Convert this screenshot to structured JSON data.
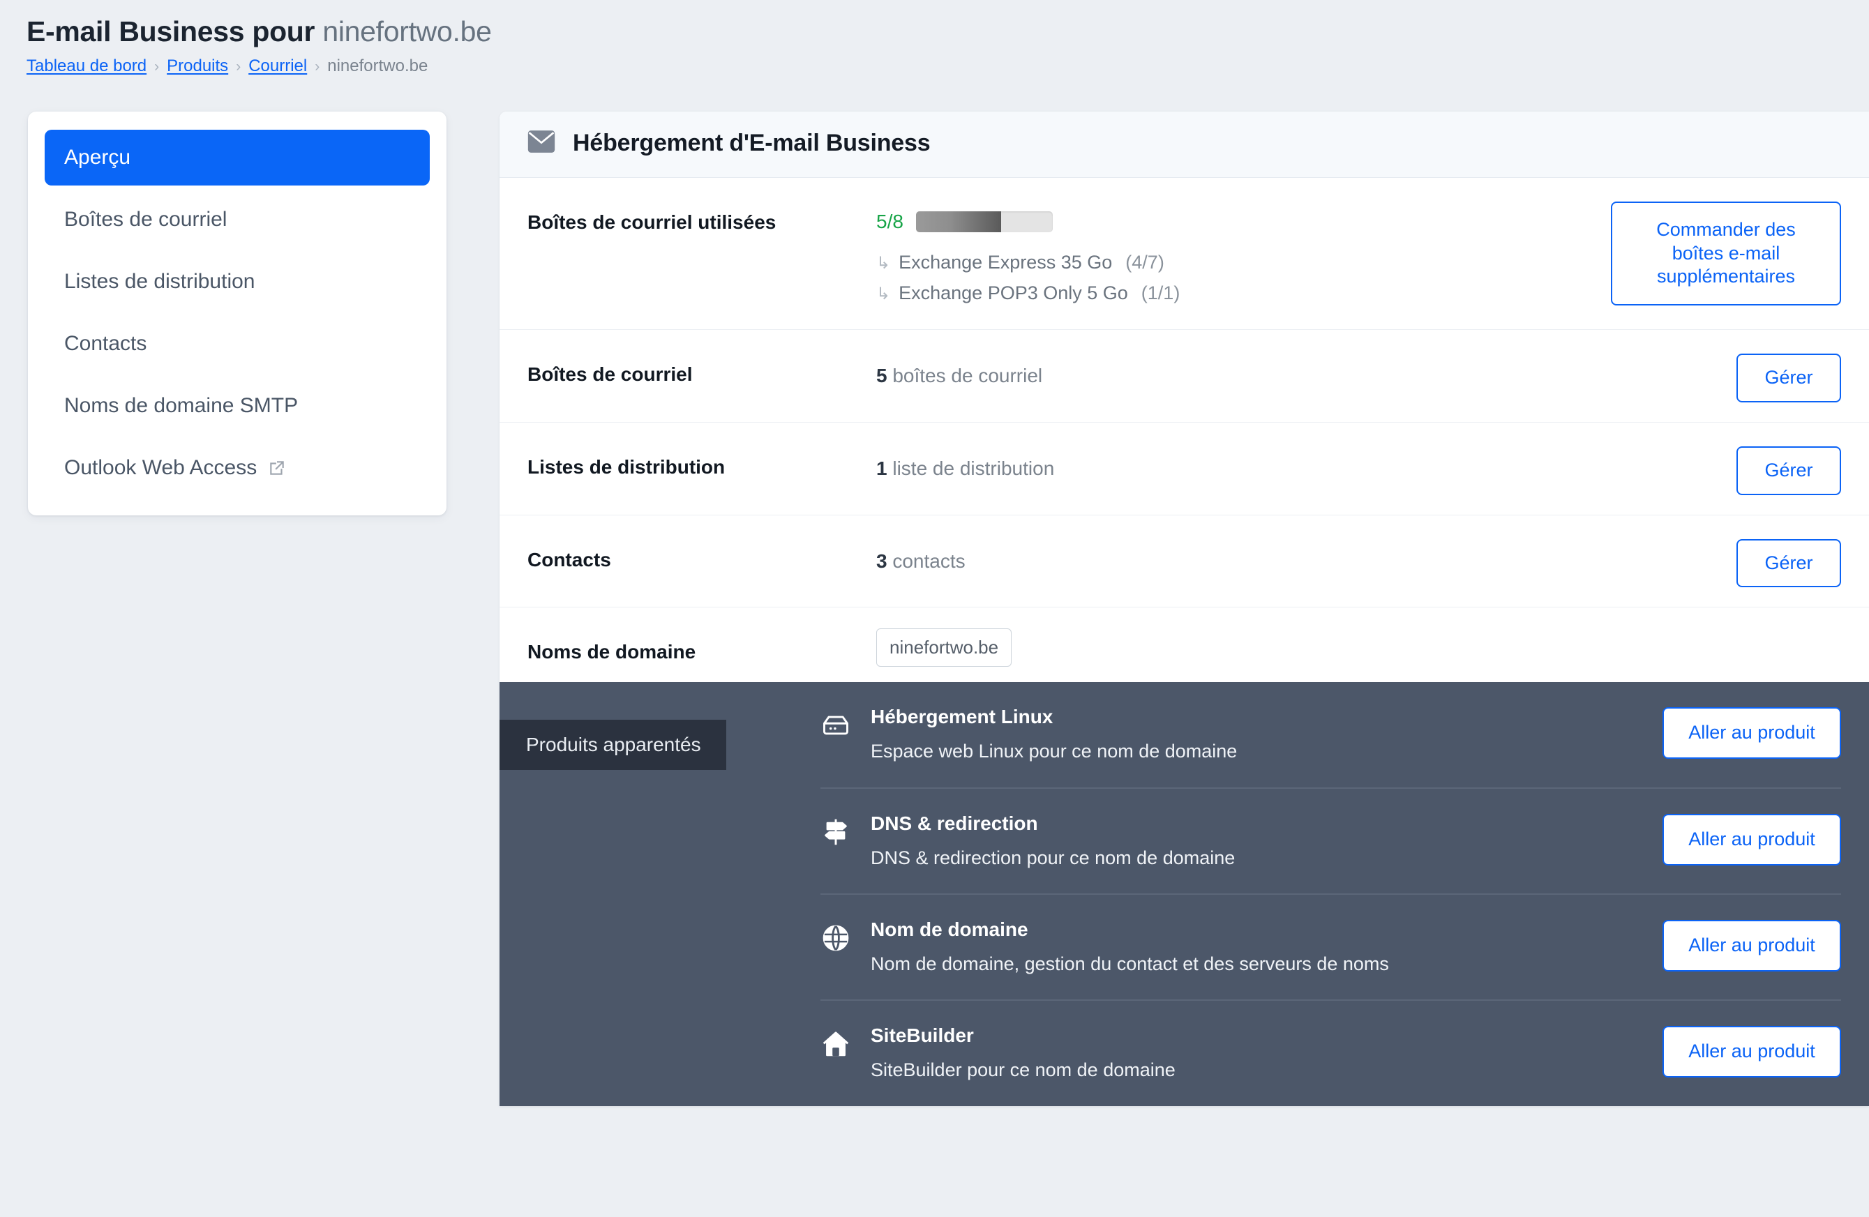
{
  "header": {
    "title_main": "E-mail Business pour ",
    "title_domain": "ninefortwo.be",
    "breadcrumb": [
      {
        "label": "Tableau de bord",
        "current": false
      },
      {
        "label": "Produits",
        "current": false
      },
      {
        "label": "Courriel",
        "current": false
      },
      {
        "label": "ninefortwo.be",
        "current": true
      }
    ],
    "separator": "›"
  },
  "sidebar": {
    "items": [
      {
        "label": "Aperçu",
        "active": true,
        "external": false
      },
      {
        "label": "Boîtes de courriel",
        "active": false,
        "external": false
      },
      {
        "label": "Listes de distribution",
        "active": false,
        "external": false
      },
      {
        "label": "Contacts",
        "active": false,
        "external": false
      },
      {
        "label": "Noms de domaine SMTP",
        "active": false,
        "external": false
      },
      {
        "label": "Outlook Web Access",
        "active": false,
        "external": true
      }
    ]
  },
  "card": {
    "icon": "envelope-icon",
    "title": "Hébergement d'E-mail Business"
  },
  "usage": {
    "label": "Boîtes de courriel utilisées",
    "count_text": "5/8",
    "used": 5,
    "total": 8,
    "percent": 62.5,
    "count_color": "#17a447",
    "arrow": "↳",
    "sub_items": [
      {
        "name": "Exchange Express 35 Go",
        "count": "(4/7)"
      },
      {
        "name": "Exchange POP3 Only 5 Go",
        "count": "(1/1)"
      }
    ],
    "order_button": "Commander des boîtes e-mail supplémentaires"
  },
  "rows": [
    {
      "label": "Boîtes de courriel",
      "value_number": "5",
      "value_text": " boîtes de courriel",
      "button": "Gérer"
    },
    {
      "label": "Listes de distribution",
      "value_number": "1",
      "value_text": " liste de distribution",
      "button": "Gérer"
    },
    {
      "label": "Contacts",
      "value_number": "3",
      "value_text": " contacts",
      "button": "Gérer"
    }
  ],
  "domains_row": {
    "label": "Noms de domaine",
    "chip": "ninefortwo.be"
  },
  "related": {
    "tag": "Produits apparentés",
    "button_label": "Aller au produit",
    "products": [
      {
        "icon": "server-icon",
        "title": "Hébergement Linux",
        "desc": "Espace web Linux pour ce nom de domaine",
        "button": "Aller au produit"
      },
      {
        "icon": "signpost-icon",
        "title": "DNS & redirection",
        "desc": "DNS & redirection pour ce nom de domaine",
        "button": "Aller au produit"
      },
      {
        "icon": "globe-icon",
        "title": "Nom de domaine",
        "desc": "Nom de domaine, gestion du contact et des serveurs de noms",
        "button": "Aller au produit"
      },
      {
        "icon": "home-icon",
        "title": "SiteBuilder",
        "desc": "SiteBuilder pour ce nom de domaine",
        "button": "Aller au produit"
      }
    ]
  },
  "colors": {
    "accent": "#0b63f6",
    "page_bg": "#eceff3",
    "dark_panel": "#4c5769",
    "dark_tag": "#2b323f",
    "success": "#17a447"
  }
}
